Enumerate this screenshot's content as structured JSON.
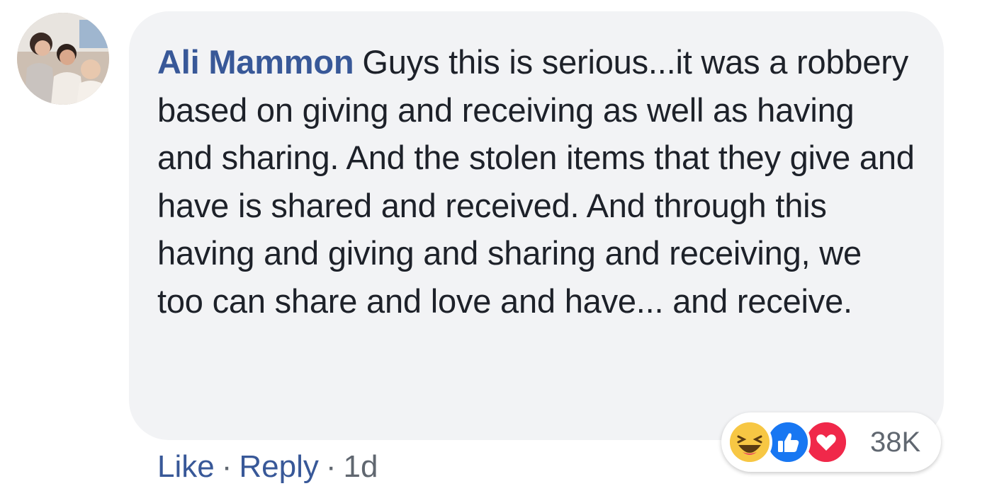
{
  "comment": {
    "author": "Ali Mammon",
    "text": "Guys this is serious...it was a robbery based on giving and receiving as well as having and sharing. And the stolen items that they give and have is shared and received. And through this having and giving and sharing and receiving, we too can share and love and have... and receive."
  },
  "actions": {
    "like_label": "Like",
    "separator": "·",
    "reply_label": "Reply",
    "timestamp": "1d"
  },
  "reactions": {
    "icons": [
      "haha-icon",
      "like-icon",
      "love-icon"
    ],
    "count": "38K"
  },
  "colors": {
    "author": "#385898",
    "bubble": "#f2f3f5",
    "text": "#1d2129",
    "meta": "#606770",
    "haha": "#f7c744",
    "like": "#1877f2",
    "love": "#f0284a"
  }
}
